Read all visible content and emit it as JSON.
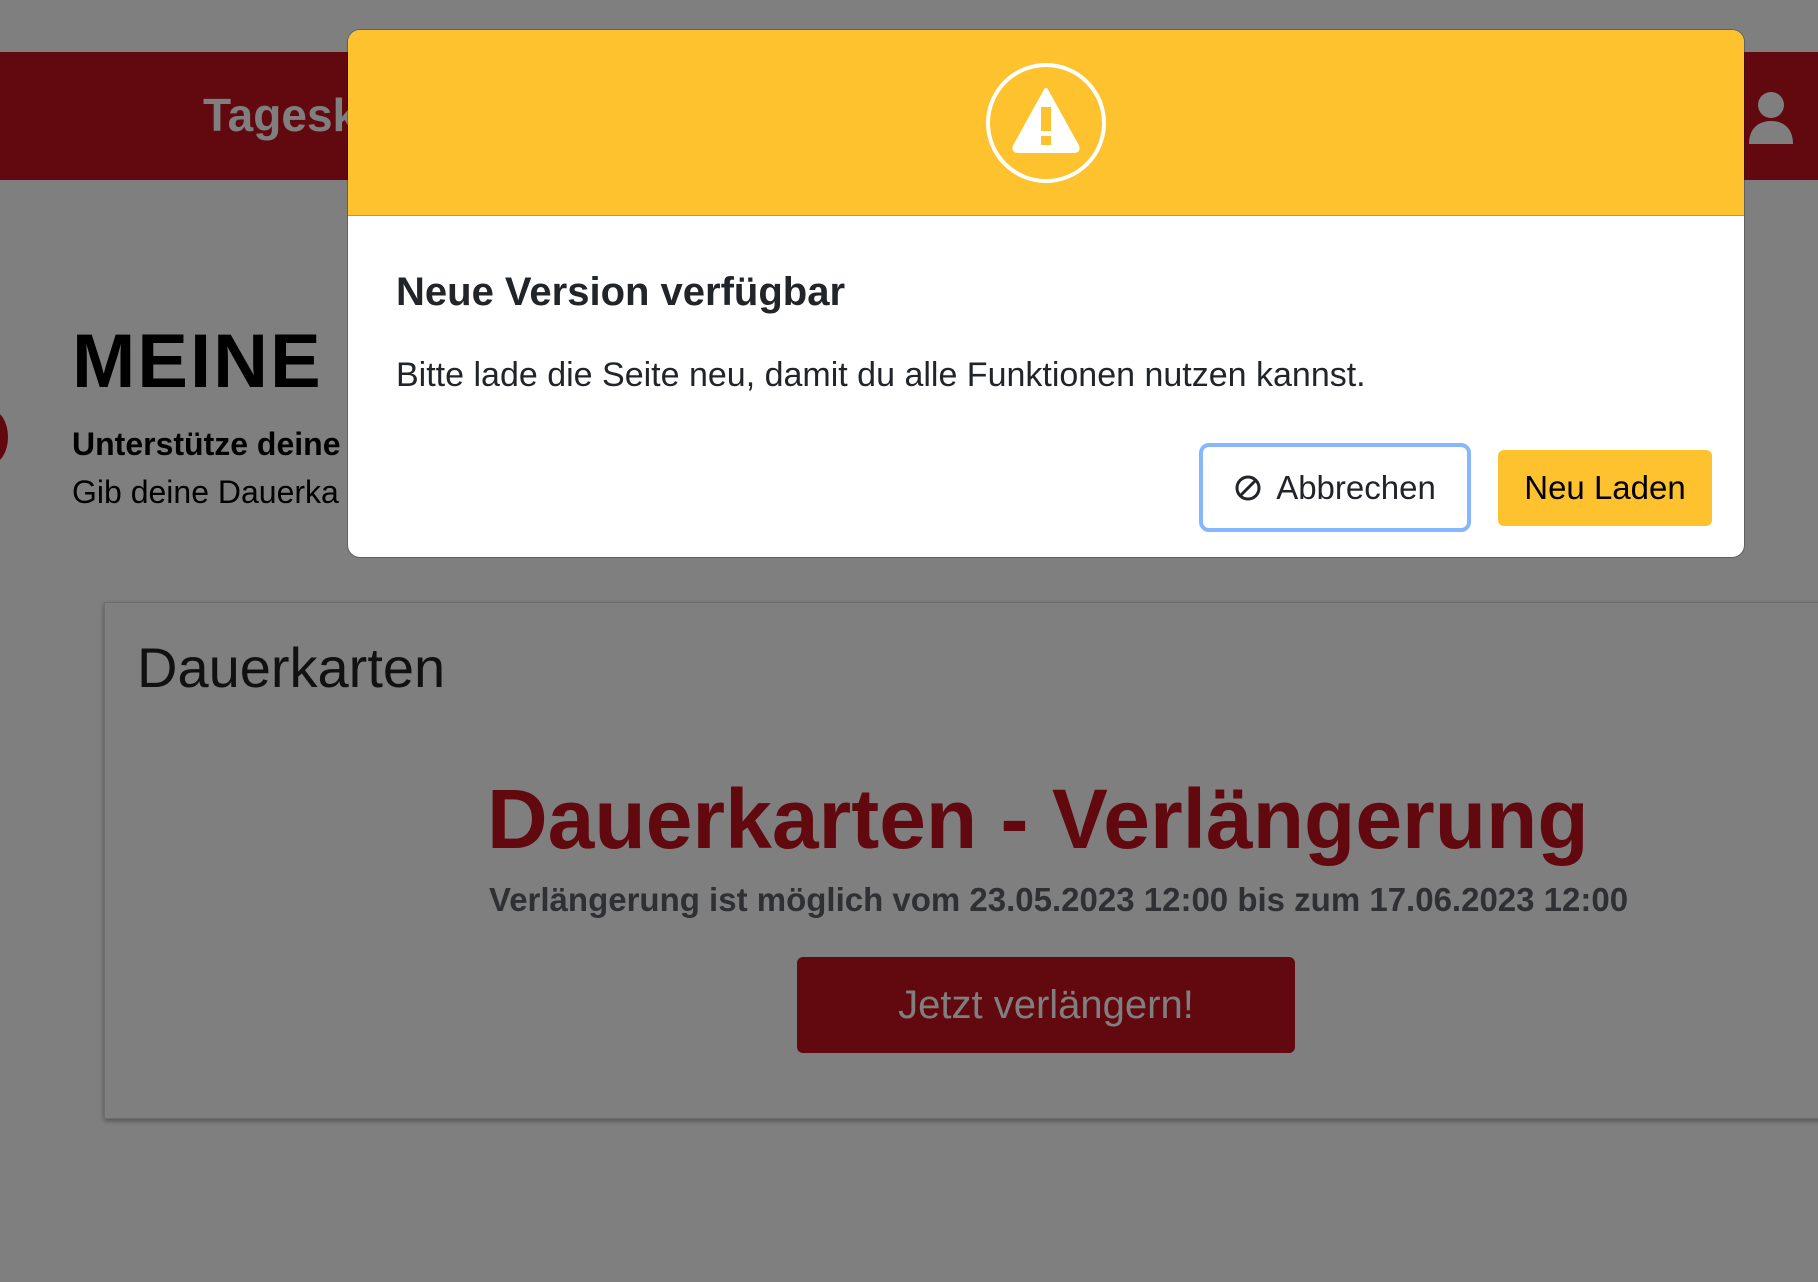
{
  "header": {
    "nav_label": "Tagesk",
    "user_icon": "user-icon"
  },
  "main": {
    "title": "MEINE D",
    "support_title": "Unterstütze deine",
    "support_text": "Gib deine Dauerka"
  },
  "card": {
    "title": "Dauerkarten",
    "renew_title": "Dauerkarten - Verlängerung",
    "renew_period": "Verlängerung ist möglich vom 23.05.2023 12:00 bis zum 17.06.2023 12:00",
    "renew_button": "Jetzt verlängern!"
  },
  "modal": {
    "icon": "warning-icon",
    "title": "Neue Version verfügbar",
    "text": "Bitte lade die Seite neu, damit du alle Funktionen nutzen kannst.",
    "cancel_label": "Abbrechen",
    "cancel_icon": "cancel-icon",
    "reload_label": "Neu Laden"
  },
  "colors": {
    "brand_red": "#c2121d",
    "warning_yellow": "#fdc22d",
    "focus_blue": "#86b7fe"
  }
}
